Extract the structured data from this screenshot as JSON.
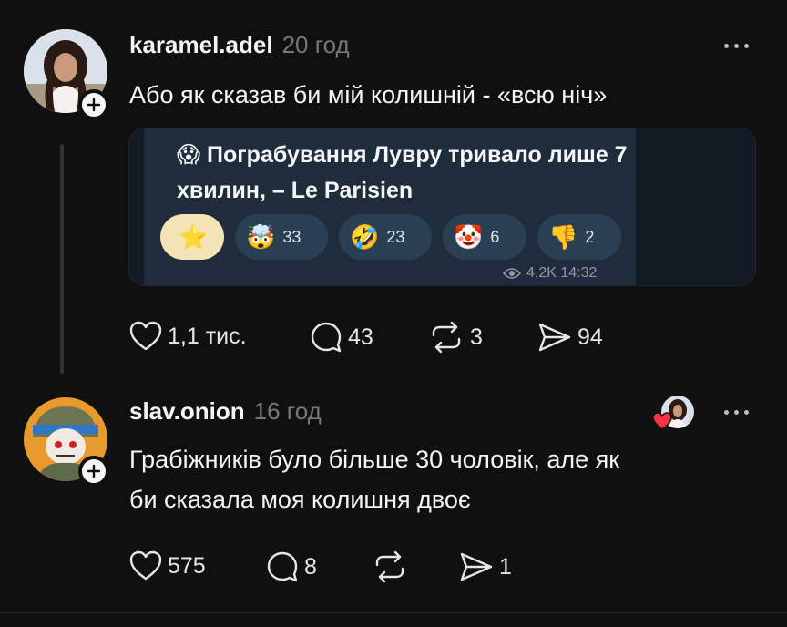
{
  "posts": [
    {
      "username": "karamel.adel",
      "time": "20 год",
      "text": "Або як сказав би мій колишній - «всю ніч»",
      "card": {
        "emoji": "😱",
        "title": "Пограбування Лувру тривало лише 7 хвилин, – Le Parisien",
        "reactions": [
          {
            "emoji": "⭐",
            "count": ""
          },
          {
            "emoji": "🤯",
            "count": "33"
          },
          {
            "emoji": "🤣",
            "count": "23"
          },
          {
            "emoji": "🤡",
            "count": "6"
          },
          {
            "emoji": "👎",
            "count": "2"
          }
        ],
        "views": "4,2K 14:32"
      },
      "likes": "1,1 тис.",
      "comments": "43",
      "reposts": "3",
      "shares": "94"
    },
    {
      "username": "slav.onion",
      "time": "16 год",
      "text_line1": "Грабіжників було більше 30 чоловік, але як",
      "text_line2": "би сказала моя колишня двоє",
      "likes": "575",
      "comments": "8",
      "reposts": "",
      "shares": "1"
    }
  ]
}
